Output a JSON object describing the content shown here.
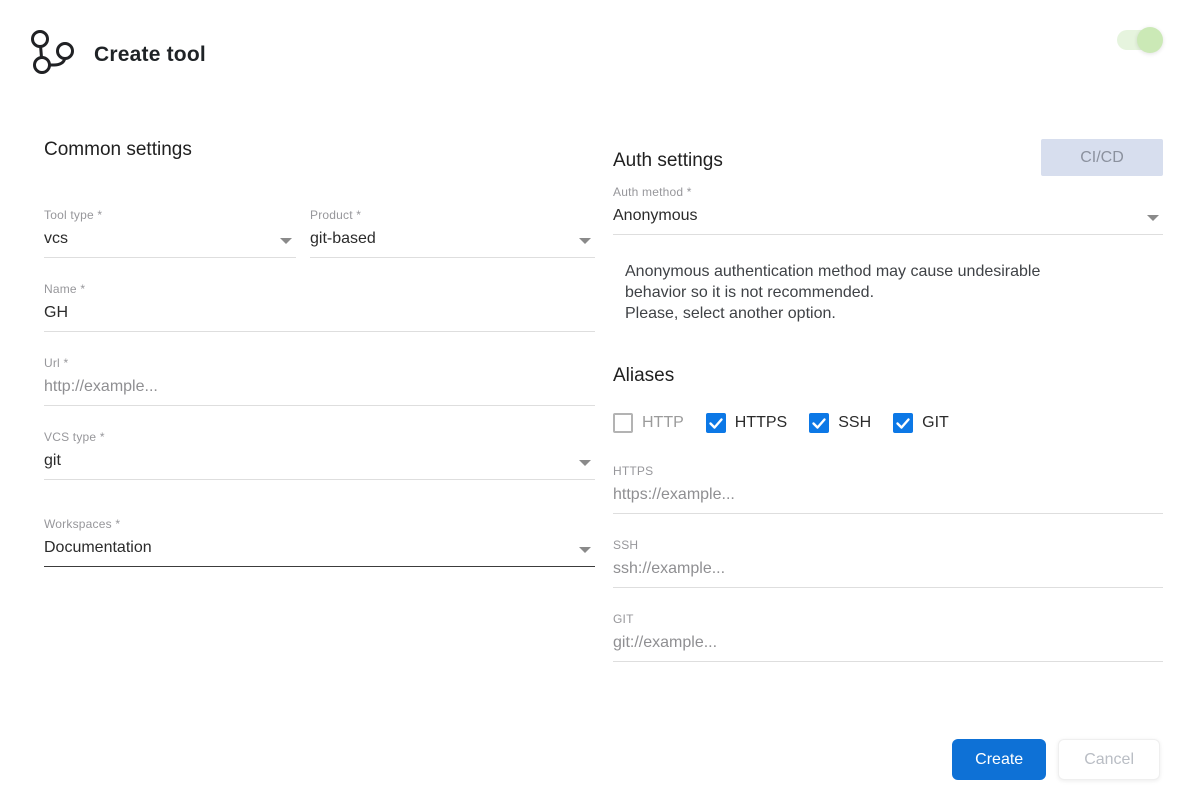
{
  "header": {
    "title": "Create tool"
  },
  "toggle": {
    "state": "on"
  },
  "common": {
    "heading": "Common settings",
    "tool_type": {
      "label": "Tool type *",
      "value": "vcs"
    },
    "product": {
      "label": "Product *",
      "value": "git-based"
    },
    "name": {
      "label": "Name *",
      "value": "GH"
    },
    "url": {
      "label": "Url *",
      "placeholder": "http://example..."
    },
    "vcs_type": {
      "label": "VCS type *",
      "value": "git"
    },
    "workspaces": {
      "label": "Workspaces *",
      "value": "Documentation"
    }
  },
  "auth": {
    "heading": "Auth settings",
    "cicd_button": "CI/CD",
    "method": {
      "label": "Auth method *",
      "value": "Anonymous"
    },
    "warning": {
      "line1": "Anonymous authentication method may cause undesirable behavior so it is not recommended.",
      "line2": "Please, select another option."
    }
  },
  "aliases": {
    "heading": "Aliases",
    "options": [
      {
        "label": "HTTP",
        "checked": false
      },
      {
        "label": "HTTPS",
        "checked": true
      },
      {
        "label": "SSH",
        "checked": true
      },
      {
        "label": "GIT",
        "checked": true
      }
    ],
    "https": {
      "label": "HTTPS",
      "placeholder": "https://example..."
    },
    "ssh": {
      "label": "SSH",
      "placeholder": "ssh://example..."
    },
    "git": {
      "label": "GIT",
      "placeholder": "git://example..."
    }
  },
  "actions": {
    "create": "Create",
    "cancel": "Cancel"
  },
  "colors": {
    "primary_blue": "#0e71d6",
    "checkbox_blue": "#0c78e6",
    "toggle_green": "#cbe9b6",
    "cicd_bg": "#d7deee"
  }
}
